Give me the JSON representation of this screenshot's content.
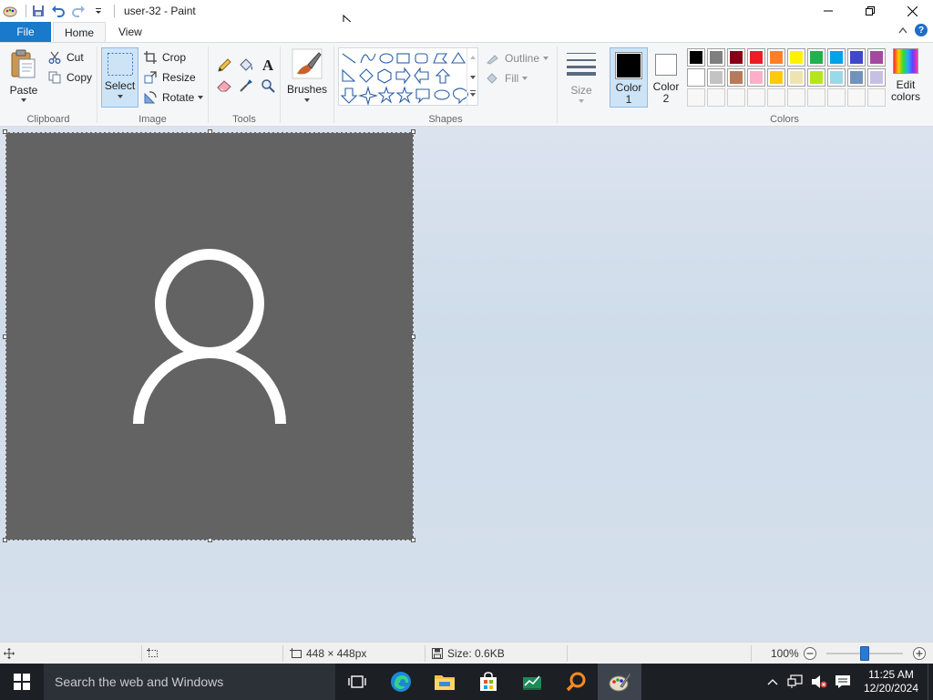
{
  "window": {
    "title": "user-32 - Paint"
  },
  "tabs": {
    "file": "File",
    "home": "Home",
    "view": "View"
  },
  "ribbon": {
    "clipboard": {
      "label": "Clipboard",
      "paste": "Paste",
      "cut": "Cut",
      "copy": "Copy"
    },
    "image": {
      "label": "Image",
      "select": "Select",
      "crop": "Crop",
      "resize": "Resize",
      "rotate": "Rotate"
    },
    "tools": {
      "label": "Tools"
    },
    "brushes": "Brushes",
    "shapes": {
      "label": "Shapes",
      "outline": "Outline",
      "fill": "Fill"
    },
    "size": "Size",
    "color1": {
      "line1": "Color",
      "line2": "1"
    },
    "color2": {
      "line1": "Color",
      "line2": "2"
    },
    "colors": {
      "label": "Colors",
      "edit_line1": "Edit",
      "edit_line2": "colors",
      "palette": [
        "#000000",
        "#7f7f7f",
        "#880015",
        "#ed1c24",
        "#ff7f27",
        "#fff200",
        "#22b14c",
        "#00a2e8",
        "#3f48cc",
        "#a349a4",
        "#ffffff",
        "#c3c3c3",
        "#b97a57",
        "#ffaec9",
        "#ffc90e",
        "#efe4b0",
        "#b5e61d",
        "#99d9ea",
        "#7092be",
        "#c8bfe7"
      ],
      "empty_slots": 10,
      "color1_value": "#000000",
      "color2_value": "#ffffff"
    }
  },
  "canvas": {
    "background": "#636363",
    "icon": "user-icon"
  },
  "status": {
    "dimensions": "448 × 448px",
    "size": "Size: 0.6KB",
    "zoom": "100%",
    "zoom_slider_percent": 50
  },
  "taskbar": {
    "search_placeholder": "Search the web and Windows",
    "time": "11:25 AM",
    "date": "12/20/2024"
  }
}
